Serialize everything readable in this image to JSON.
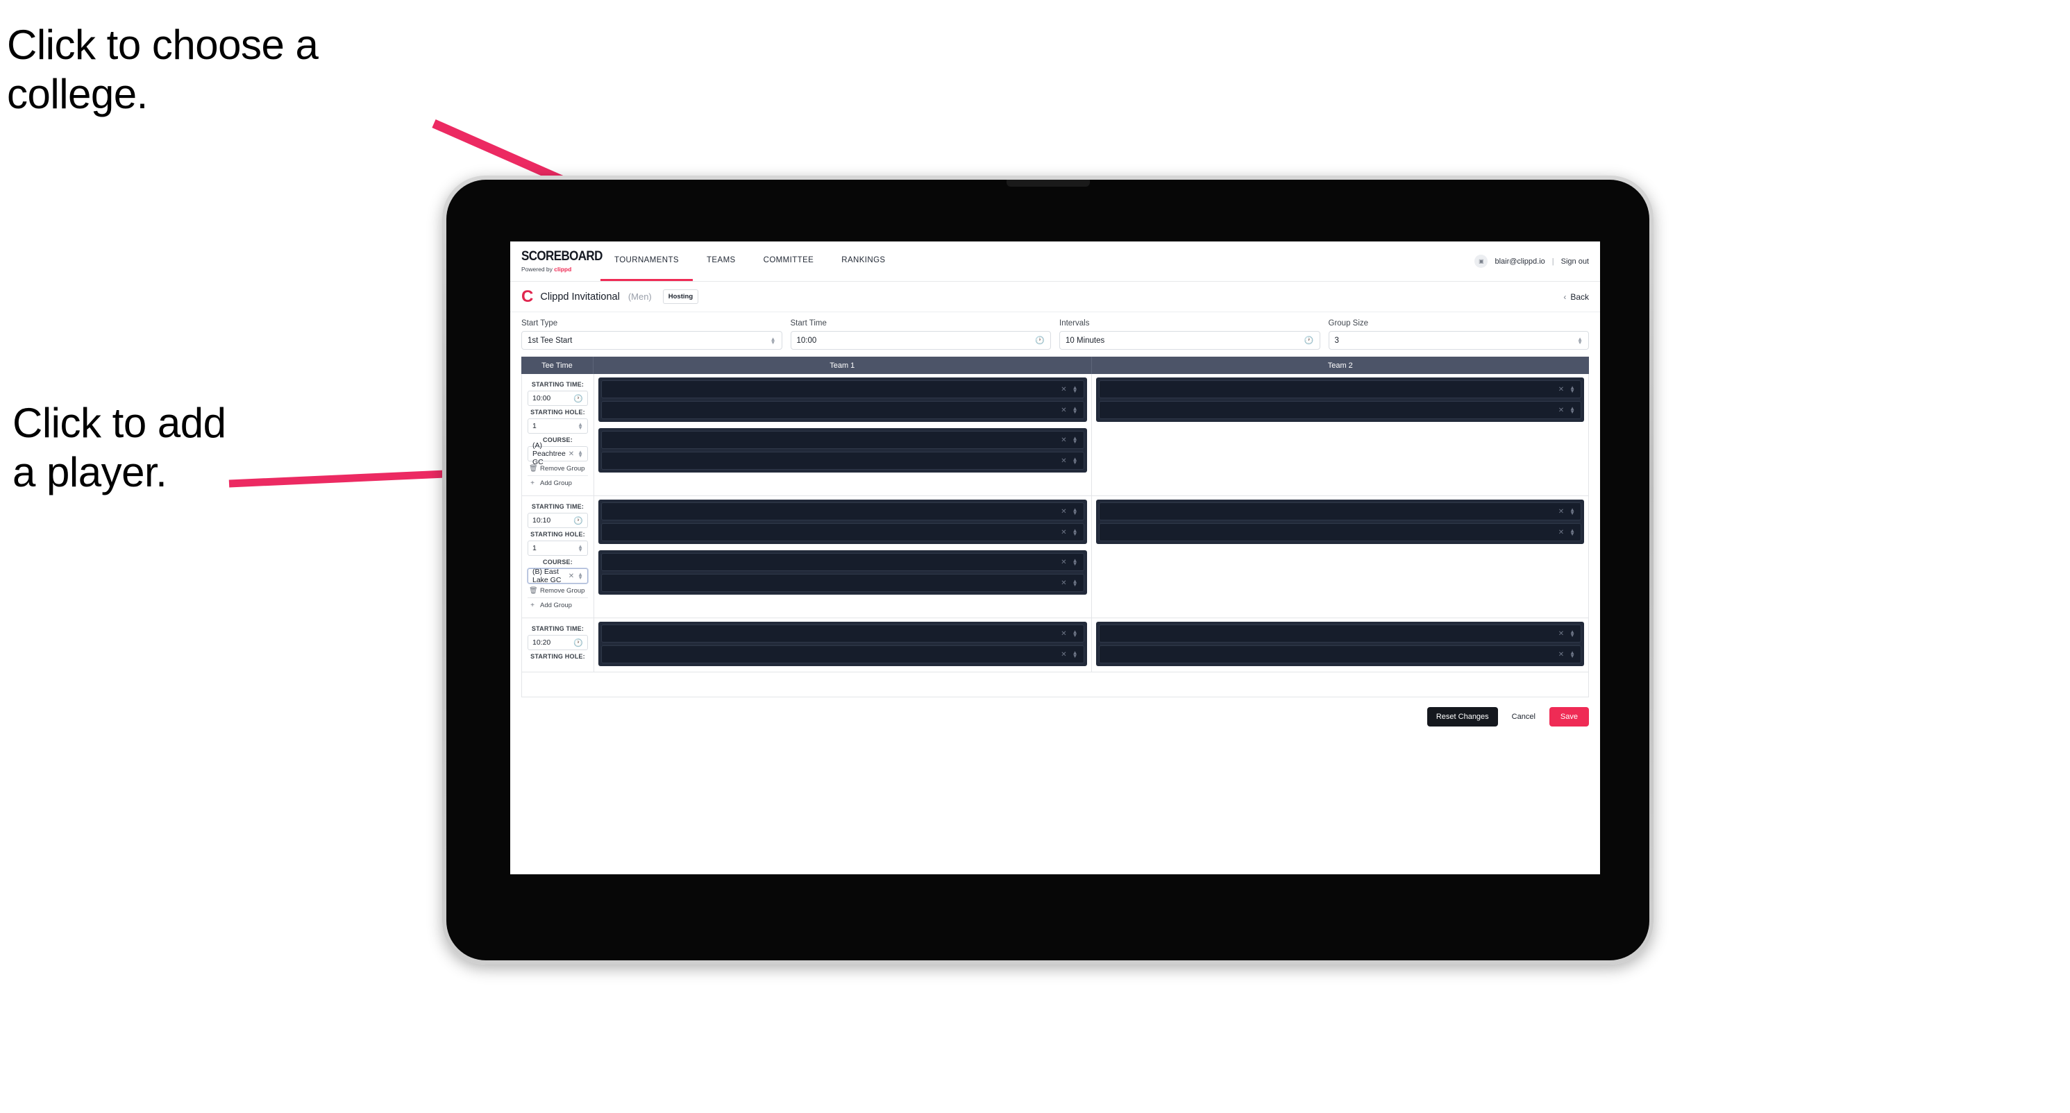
{
  "annotations": {
    "college": "Click to choose a\ncollege.",
    "player": "Click to add\na player."
  },
  "colors": {
    "accent": "#ef2b55",
    "arrow": "#ec2a62",
    "table_header_bg": "#4c5468",
    "player_panel_bg": "#222a3a",
    "player_select_bg": "#161d2b",
    "dark_button_bg": "#15181e"
  },
  "topnav": {
    "logo_word": "SCOREBOARD",
    "logo_sub_prefix": "Powered by ",
    "logo_sub_brand": "clippd",
    "links": [
      {
        "label": "TOURNAMENTS",
        "active": true
      },
      {
        "label": "TEAMS",
        "active": false
      },
      {
        "label": "COMMITTEE",
        "active": false
      },
      {
        "label": "RANKINGS",
        "active": false
      }
    ],
    "account": {
      "avatar_glyph": "▣",
      "email": "blair@clippd.io",
      "separator": "|",
      "sign_out": "Sign out"
    }
  },
  "crumbs": {
    "logo_letter": "C",
    "title": "Clippd Invitational",
    "gender": "(Men)",
    "badge": "Hosting",
    "back_chevron": "‹",
    "back_label": "Back"
  },
  "settings": [
    {
      "label": "Start Type",
      "value": "1st Tee Start",
      "icon": "stepper"
    },
    {
      "label": "Start Time",
      "value": "10:00",
      "icon": "clock"
    },
    {
      "label": "Intervals",
      "value": "10 Minutes",
      "icon": "clock"
    },
    {
      "label": "Group Size",
      "value": "3",
      "icon": "stepper"
    }
  ],
  "table": {
    "headers": {
      "tee_time": "Tee Time",
      "team1": "Team 1",
      "team2": "Team 2"
    },
    "labels": {
      "starting_time": "STARTING TIME:",
      "starting_hole": "STARTING HOLE:",
      "course": "COURSE:",
      "remove_group": "Remove Group",
      "add_group": "Add Group",
      "remove_icon": "Ὕ1",
      "add_icon": "+",
      "clear_icon": "✕"
    },
    "rows": [
      {
        "starting_time": "10:00",
        "starting_hole": "1",
        "course": "(A) Peachtree GC",
        "course_focused": false,
        "team1_panels": [
          {
            "players": [
              "",
              ""
            ]
          },
          {
            "players": [
              "",
              ""
            ]
          }
        ],
        "team2_panels": [
          {
            "players": [
              "",
              ""
            ]
          }
        ]
      },
      {
        "starting_time": "10:10",
        "starting_hole": "1",
        "course": "(B) East Lake GC",
        "course_focused": true,
        "team1_panels": [
          {
            "players": [
              "",
              ""
            ]
          },
          {
            "players": [
              "",
              ""
            ]
          }
        ],
        "team2_panels": [
          {
            "players": [
              "",
              ""
            ]
          }
        ]
      },
      {
        "starting_time": "10:20",
        "starting_hole": "",
        "course": "",
        "course_focused": false,
        "team1_panels": [
          {
            "players": [
              "",
              ""
            ]
          }
        ],
        "team2_panels": [
          {
            "players": [
              "",
              ""
            ]
          }
        ]
      }
    ]
  },
  "footer": {
    "reset": "Reset Changes",
    "cancel": "Cancel",
    "save": "Save"
  }
}
